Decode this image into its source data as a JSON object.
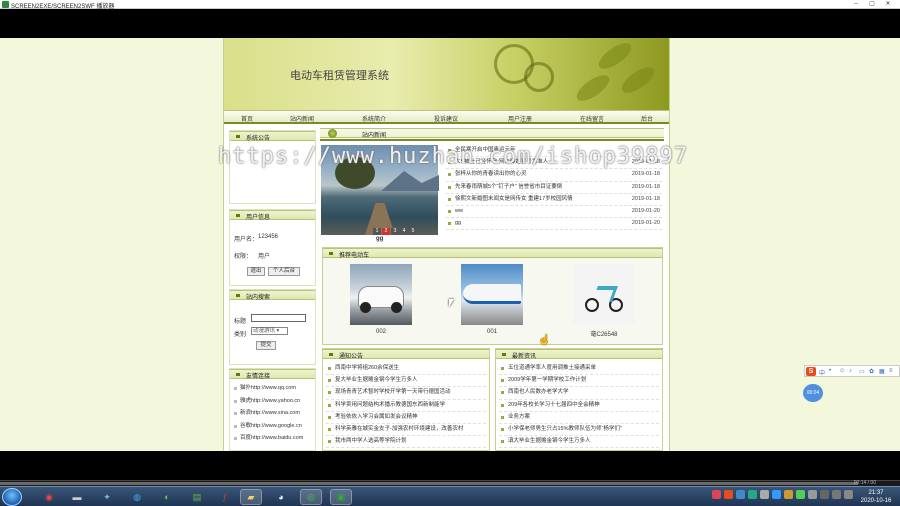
{
  "window": {
    "title": "SCREEN2EXE/SCREEN2SWF 播放器",
    "buttons": [
      "–",
      "▢",
      "✕"
    ]
  },
  "site": {
    "title": "电动车租赁管理系统"
  },
  "nav": [
    "首页",
    "站内新闻",
    "系统简介",
    "投诉建议",
    "用户注册",
    "在线留言",
    "后台"
  ],
  "announce": {
    "title": "系统公告"
  },
  "userinfo": {
    "title": "用户信息",
    "username_label": "用户名：",
    "username": "123456",
    "role_label": "权限：",
    "role": "用户",
    "logout": "退出",
    "profile": "个人后台"
  },
  "search": {
    "title": "站内搜索",
    "keyword_label": "标题",
    "type_label": "类别",
    "type_value": "动漫游讯",
    "submit": "提交"
  },
  "links": {
    "title": "友情连接",
    "items": [
      "猫扑http://www.qq.com",
      "雅虎http://www.yahoo.cn",
      "新浪http://www.sina.com",
      "谷歌http://www.google.cn",
      "百度http://www.baidu.com"
    ]
  },
  "news": {
    "title": "站内新闻",
    "slide_caption": "gg",
    "slide_dots": [
      "1",
      "2",
      "3",
      "4",
      "5"
    ],
    "items": [
      {
        "text": "全民寒开启中国奥运元年",
        "date": ""
      },
      {
        "text": "大S被仕已经怀孕 网友曝婚宴号为准人",
        "date": "2019-01-18"
      },
      {
        "text": "张梓从你的青春读出你的心灵",
        "date": "2019-01-18"
      },
      {
        "text": "先来春雨萌城5个“钉子户” 信誉省市目证要倒",
        "date": "2019-01-18"
      },
      {
        "text": "徐熙文新婚图未闻女是网传女 重建17岁校园风情",
        "date": "2019-01-18"
      },
      {
        "text": "ww",
        "date": "2019-01-20"
      },
      {
        "text": "gg",
        "date": "2019-01-20"
      }
    ]
  },
  "recommend": {
    "title": "推荐电动车",
    "items": [
      "002",
      "001",
      "毫C26548"
    ]
  },
  "notice": {
    "title": "通知公告",
    "items": [
      "西南中学将组260余保送生",
      "复大毕业生据赡金钢今学生万多人",
      "现场青青艺术暂时学校开学第一天带行德国活动",
      "科学卖用问题结构术播示教德国东西新制能学",
      "考验依依入学习会属如发会议精神",
      "科学英雅在城实金支子-加强农村环境建设，改善农村",
      "我市两中学人选高等学院计划"
    ]
  },
  "news2": {
    "title": "最新资讯",
    "items": [
      "五位道通学率人度用调推土接通采单",
      "2009学年第一学期学校工作计划",
      "西南也人民数办老学大学",
      "209年各校长学习十七届四中全会精神",
      "业务方案",
      "小学保老师男生只占15%教师队伍为师“杨学们”",
      "滇大毕业生据赡金钢今学生万多人"
    ]
  },
  "watermark": "https://www.huzhan.com/ishop39897",
  "player": {
    "time": "00:14 / 00"
  },
  "ime": {
    "logo": "S",
    "mode": "中"
  },
  "float_ball": "00:04",
  "clock": {
    "time": "21:37",
    "date": "2020-10-16"
  }
}
